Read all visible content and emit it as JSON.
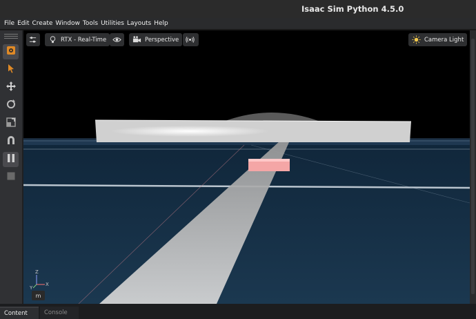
{
  "window": {
    "title": "Isaac Sim Python 4.5.0"
  },
  "menu": [
    "File",
    "Edit",
    "Create",
    "Window",
    "Tools",
    "Utilities",
    "Layouts",
    "Help"
  ],
  "viewport": {
    "render_mode": "RTX - Real-Time",
    "camera": "Perspective",
    "lighting": "Camera Light",
    "units": "m",
    "axis_labels": {
      "z": "Z",
      "x": "X",
      "y": "Y"
    }
  },
  "tabs": {
    "content": "Content",
    "console": "Console"
  },
  "colors": {
    "accent_orange": "#e08a26",
    "cube": "#f4a6a6",
    "floor": "#17324a"
  },
  "icons": {
    "toolbar": [
      "orange-select-icon",
      "select-arrow-icon",
      "move-icon",
      "rotate-icon",
      "scale-icon",
      "snap-icon",
      "pause-icon",
      "stop-icon"
    ],
    "viewport": [
      "settings-sliders-icon",
      "lightbulb-icon",
      "eye-icon",
      "camera-icon",
      "broadcast-icon",
      "sun-icon"
    ]
  }
}
